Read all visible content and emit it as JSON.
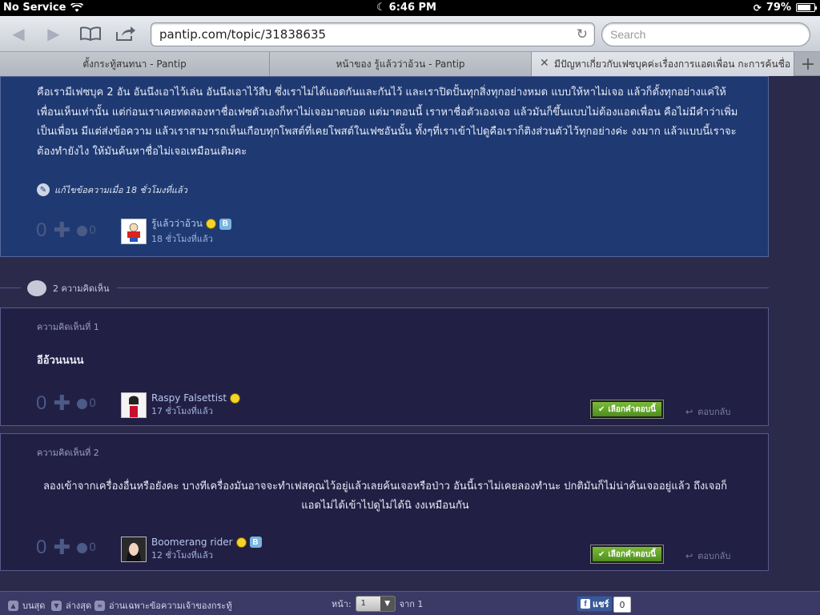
{
  "status": {
    "carrier": "No Service",
    "time": "6:46 PM",
    "battery": "79%",
    "battery_level": 0.79
  },
  "browser": {
    "url": "pantip.com/topic/31838635",
    "search_placeholder": "Search",
    "tabs": [
      {
        "label": "ตั้งกระทู้สนทนา - Pantip"
      },
      {
        "label": "หน้าของ รู้แล้วว่าอ้วน - Pantip"
      },
      {
        "label": "มีปัญหาเกี่ยวกับเฟซบุคค่ะเรื่องการแอดเพื่อน กะการค้นชื่อ -..."
      }
    ]
  },
  "post": {
    "body": "คือเรามีเฟซบุค 2 อัน อันนึงเอาไว้เล่น อันนึงเอาไว้สืบ ซึ่งเราไม่ได้แอดกันและกันไว้ และเราปิดปั้นทุกสิ่งทุกอย่างหมด แบบให้หาไม่เจอ แล้วก็ตั้งทุกอย่างแค่ให้เพื่อนเห็นเท่านั้น แต่ก่อนเราเคยทดลองหาชื่อเฟซตัวเองก็หาไม่เจอมาตบอด แต่มาตอนนี้ เราหาชื่อตัวเองเจอ แล้วมันก็ขึ้นแบบไม่ต้องแอดเพื่อน คือไม่มีคำว่าเพิ่มเป็นเพื่อน มีแต่ส่งข้อความ แล้วเราสามารถเห็นเกือบทุกโพสต์ที่เคยโพสต์ในเฟซอันนั้น ทั้งๆที่เราเข้าไปดูคือเราก็ติงส่วนตัวไว้ทุกอย่างค่ะ งงมาก แล้วแบบนี้เราจะต้องทำยังไง ให้มันค้นหาชื่อไม่เจอเหมือนเดิมคะ",
    "edited": "แก้ไขข้อความเมื่อ 18 ชั่วโมงที่แล้ว",
    "votes": "0",
    "emotions": "0",
    "author": "รู้แล้วว่าอ้วน",
    "time": "18 ชั่วโมงที่แล้ว"
  },
  "comments_header": "2 ความคิดเห็น",
  "comments": [
    {
      "number": "ความคิดเห็นที่ 1",
      "text": "อีอ้วนนนน",
      "votes": "0",
      "emotions": "0",
      "author": "Raspy Falsettist",
      "time": "17 ชั่วโมงที่แล้ว",
      "pick_label": "เลือกคำตอบนี้",
      "reply_label": "ตอบกลับ"
    },
    {
      "number": "ความคิดเห็นที่ 2",
      "text": "ลองเข้าจากเครื่องอื่นหรือยังคะ บางทีเครื่องมันอาจจะทำเฟสคุณไว้อยู่แล้วเลยค้นเจอหรือป่าว อันนี้เราไม่เคยลองทำนะ ปกติมันก็ไม่น่าค้นเจออยู่แล้ว ถึงเจอก็แอดไม่ได้เข้าไปดูไม่ได้นิ งงเหมือนกัน",
      "votes": "0",
      "emotions": "0",
      "author": "Boomerang rider",
      "time": "12 ชั่วโมงที่แล้ว",
      "pick_label": "เลือกคำตอบนี้",
      "reply_label": "ตอบกลับ"
    }
  ],
  "footer": {
    "top": "บนสุด",
    "bottom": "ล่างสุด",
    "owner_only": "อ่านเฉพาะข้อความเจ้าของกระทู้",
    "page_label": "หน้า:",
    "page_value": "1",
    "of_label": "จาก 1",
    "share_label": "แชร์",
    "share_count": "0"
  }
}
